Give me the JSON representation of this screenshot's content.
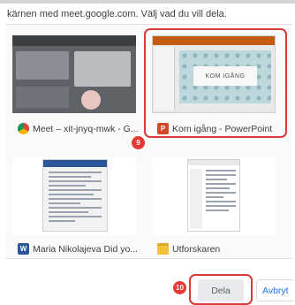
{
  "dialog": {
    "prompt": "kärnen med meet.google.com. Välj vad du vill dela."
  },
  "windows": [
    {
      "label": "Meet – xit-jnyq-mwk - G...",
      "icon": "chrome-icon",
      "color": "#e8453c"
    },
    {
      "label": "Kom igång - PowerPoint",
      "icon": "powerpoint-icon",
      "color": "#d24726",
      "slide_text": "KOM IGÅNG"
    },
    {
      "label": "Maria Nikolajeva Did yo...",
      "icon": "word-icon",
      "color": "#2b579a"
    },
    {
      "label": "Utforskaren",
      "icon": "folder-icon",
      "color": "#f3c13a"
    }
  ],
  "steps": {
    "select_step": "9",
    "share_step": "10"
  },
  "buttons": {
    "share": "Dela",
    "cancel": "Avbryt"
  },
  "colors": {
    "highlight": "#d93a3a",
    "badge": "#e53935",
    "cancel_text": "#1a73e8"
  }
}
